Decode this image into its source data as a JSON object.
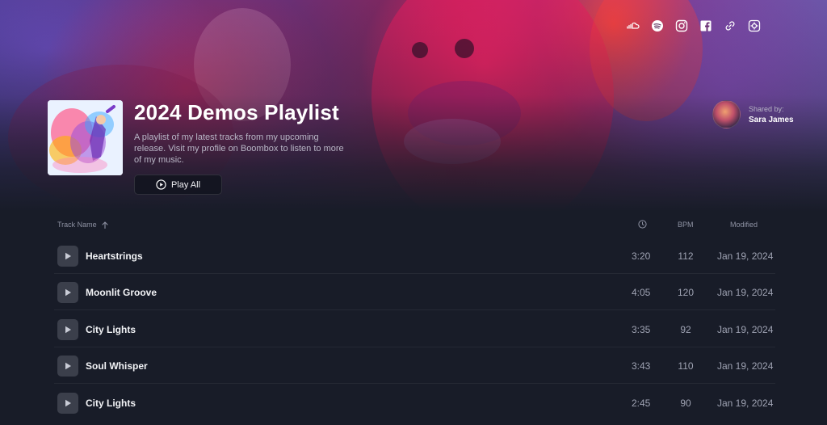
{
  "social_links": [
    {
      "name": "soundcloud-icon"
    },
    {
      "name": "spotify-icon"
    },
    {
      "name": "instagram-icon"
    },
    {
      "name": "facebook-icon"
    },
    {
      "name": "link-icon"
    },
    {
      "name": "settings-icon"
    }
  ],
  "playlist": {
    "title": "2024 Demos Playlist",
    "description": "A playlist of my latest tracks from my upcoming release. Visit my profile on Boombox to listen to more of my music.",
    "play_all_label": "Play All"
  },
  "shared_by": {
    "label": "Shared by:",
    "name": "Sara James"
  },
  "table": {
    "headers": {
      "name": "Track Name",
      "bpm": "BPM",
      "modified": "Modified"
    },
    "rows": [
      {
        "name": "Heartstrings",
        "duration": "3:20",
        "bpm": "112",
        "modified": "Jan 19, 2024"
      },
      {
        "name": "Moonlit Groove",
        "duration": "4:05",
        "bpm": "120",
        "modified": "Jan 19, 2024"
      },
      {
        "name": "City Lights",
        "duration": "3:35",
        "bpm": "92",
        "modified": "Jan 19, 2024"
      },
      {
        "name": "Soul Whisper",
        "duration": "3:43",
        "bpm": "110",
        "modified": "Jan 19, 2024"
      },
      {
        "name": "City Lights",
        "duration": "2:45",
        "bpm": "90",
        "modified": "Jan 19, 2024"
      }
    ]
  },
  "colors": {
    "background": "#181c28",
    "accent_pink": "#ff2a6e",
    "accent_purple": "#6b56a8"
  }
}
